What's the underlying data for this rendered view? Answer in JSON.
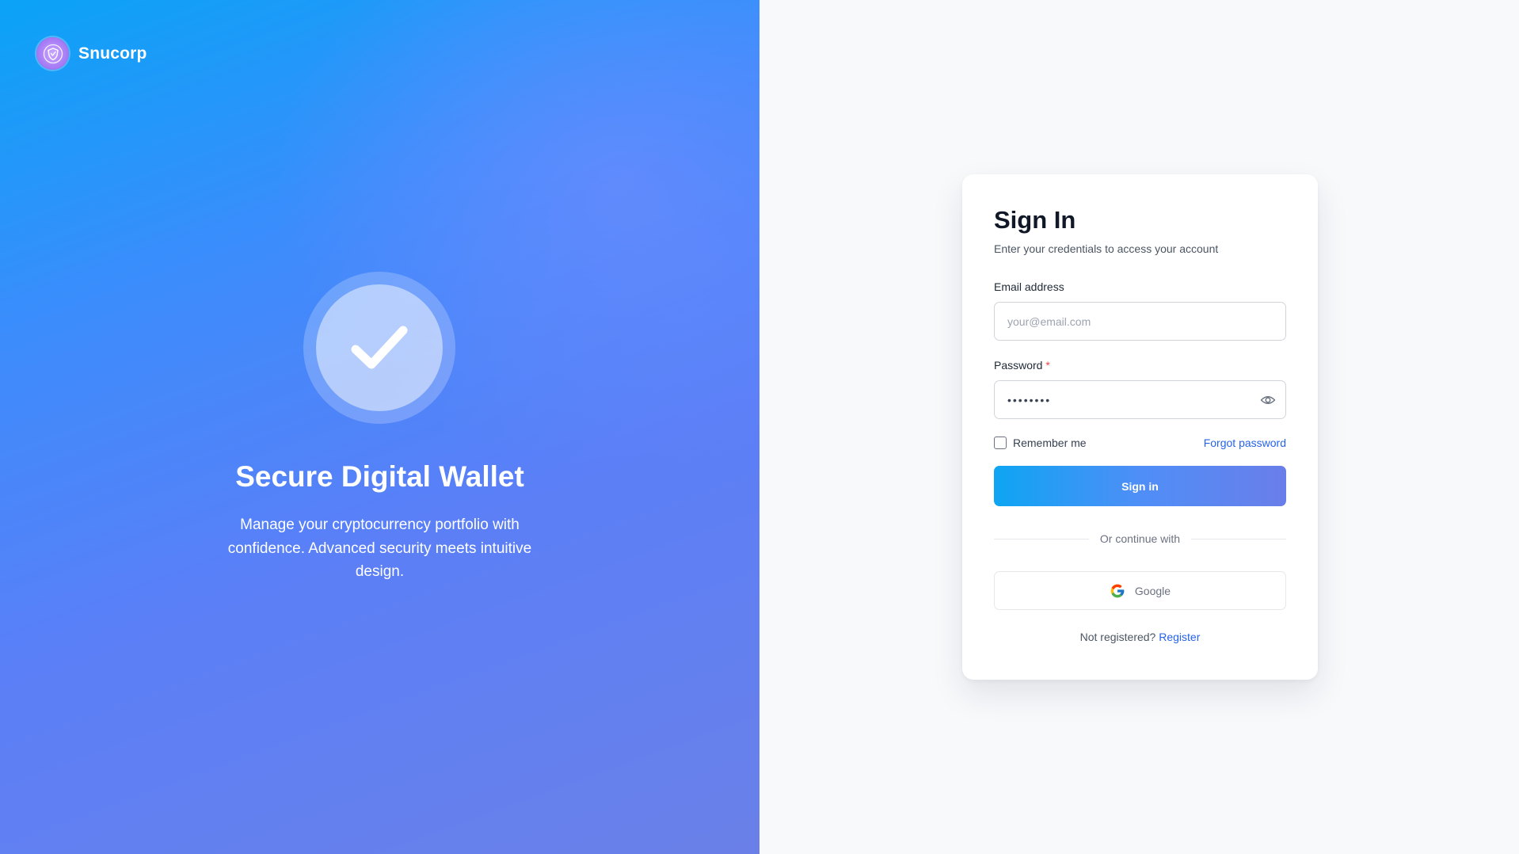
{
  "brand": {
    "name": "Snucorp",
    "logo_icon": "shield-logo-icon"
  },
  "hero": {
    "title": "Secure Digital Wallet",
    "subtitle": "Manage your cryptocurrency portfolio with confidence. Advanced security meets intuitive design.",
    "icon": "checkmark-icon"
  },
  "signin": {
    "title": "Sign In",
    "subtitle": "Enter your credentials to access your account",
    "email": {
      "label": "Email address",
      "placeholder": "your@email.com",
      "value": ""
    },
    "password": {
      "label": "Password",
      "required_mark": "*",
      "value": "••••••••",
      "toggle_icon": "eye-icon"
    },
    "remember_label": "Remember me",
    "remember_checked": false,
    "forgot_label": "Forgot password",
    "submit_label": "Sign in",
    "divider_label": "Or continue with",
    "google_label": "Google",
    "footer_text": "Not registered?",
    "register_label": "Register"
  },
  "colors": {
    "accent_link": "#2563eb",
    "required": "#ef4444",
    "hero_gradient_start": "#0aa3f7",
    "hero_gradient_end": "#6a80e8"
  }
}
